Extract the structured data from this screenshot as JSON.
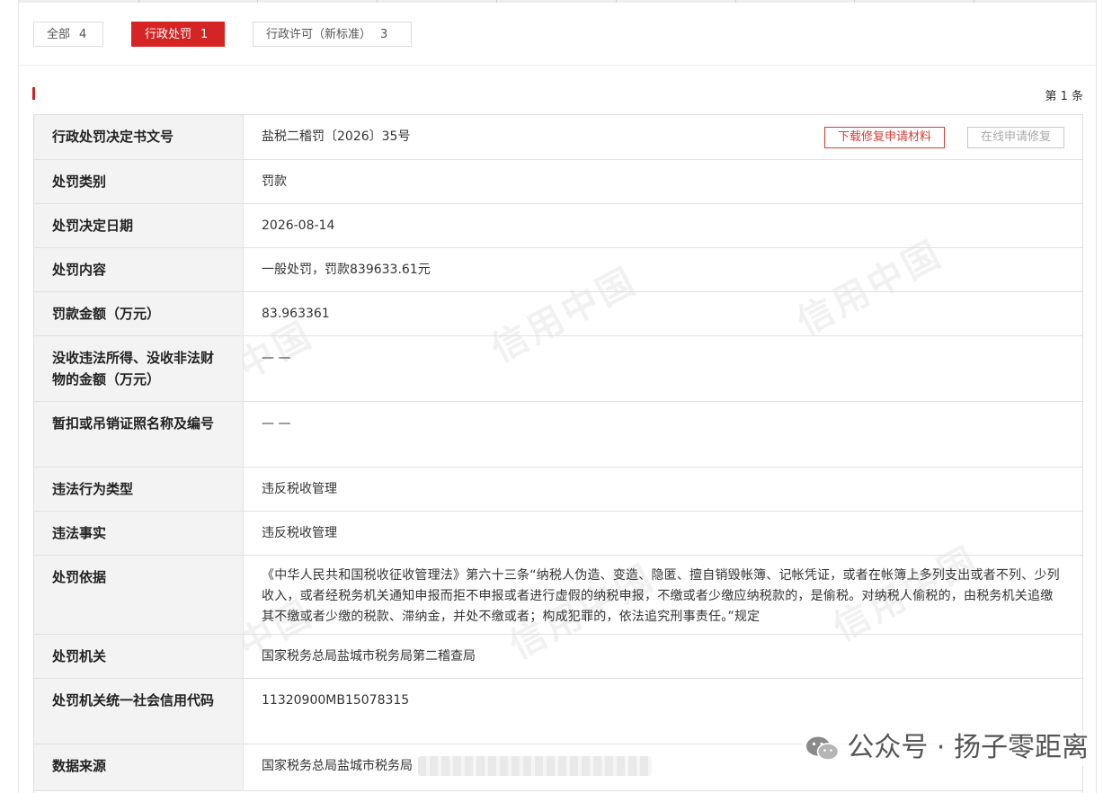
{
  "tabs": [
    {
      "label": "全部",
      "count": "4",
      "active": false
    },
    {
      "label": "行政处罚",
      "count": "1",
      "active": true
    },
    {
      "label": "行政许可（新标准）",
      "count": "3",
      "active": false
    }
  ],
  "page_count": "第 1 条",
  "buttons": {
    "download": "下载修复申请材料",
    "online": "在线申请修复"
  },
  "rows": [
    {
      "label": "行政处罚决定书文号",
      "value": "盐税二稽罚〔2026〕35号"
    },
    {
      "label": "处罚类别",
      "value": "罚款"
    },
    {
      "label": "处罚决定日期",
      "value": "2026-08-14"
    },
    {
      "label": "处罚内容",
      "value": "一般处罚，罚款839633.61元"
    },
    {
      "label": "罚款金额（万元）",
      "value": "83.963361"
    },
    {
      "label": "没收违法所得、没收非法财物的金额（万元）",
      "value": "— —"
    },
    {
      "label": "暂扣或吊销证照名称及编号",
      "value": "— —"
    },
    {
      "label": "违法行为类型",
      "value": "违反税收管理"
    },
    {
      "label": "违法事实",
      "value": "违反税收管理"
    },
    {
      "label": "处罚依据",
      "value": "《中华人民共和国税收征收管理法》第六十三条“纳税人伪造、变造、隐匿、擅自销毁帐簿、记帐凭证，或者在帐簿上多列支出或者不列、少列收入，或者经税务机关通知申报而拒不申报或者进行虚假的纳税申报，不缴或者少缴应纳税款的，是偷税。对纳税人偷税的，由税务机关追缴其不缴或者少缴的税款、滞纳金，并处不缴或者；构成犯罪的，依法追究刑事责任。”规定"
    },
    {
      "label": "处罚机关",
      "value": "国家税务总局盐城市税务局第二稽查局"
    },
    {
      "label": "处罚机关统一社会信用代码",
      "value": "11320900MB15078315"
    },
    {
      "label": "数据来源",
      "value": "国家税务总局盐城市税务局"
    }
  ],
  "watermark_text": "信用中国",
  "wechat_mark": "公众号 · 扬子零距离",
  "colors": {
    "accent": "#d42424",
    "button_red": "#d33d38",
    "label_bg": "#f3f3f3"
  }
}
